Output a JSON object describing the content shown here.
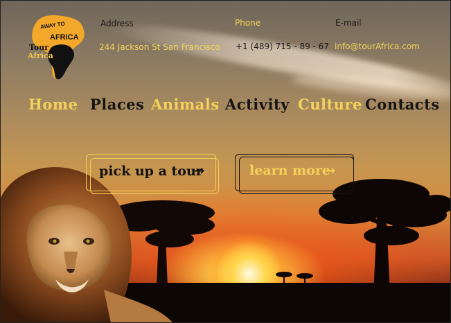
{
  "logo": {
    "line1": "AWAY TO",
    "line2": "AFRICA",
    "tour": "Tour",
    "africa": "Africa"
  },
  "contact": {
    "address_label": "Address",
    "address_value": "244 Jackson St San Francisco",
    "phone_label": "Phone",
    "phone_value": "+1 (489) 715 - 89 - 67",
    "email_label": "E-mail",
    "email_value": "info@tourAfrica.com"
  },
  "nav": {
    "home": "Home",
    "places": "Places",
    "animals": "Animals",
    "activity": "Activity",
    "culture": "Culture",
    "contacts": "Contacts"
  },
  "cta": {
    "tour_label": "pick up a tour",
    "learn_label": "learn more",
    "arrow": "→"
  },
  "colors": {
    "accent_yellow": "#f3d15a",
    "dark_text": "#151515"
  }
}
